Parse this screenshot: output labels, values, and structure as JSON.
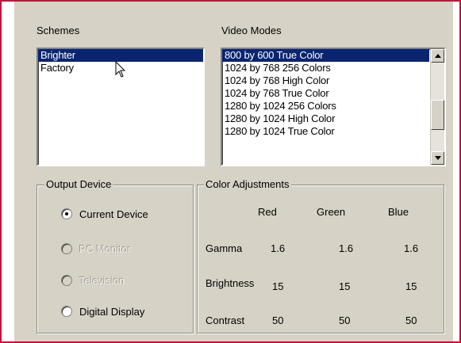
{
  "schemes": {
    "label": "Schemes",
    "items": [
      {
        "label": "Brighter",
        "selected": true
      },
      {
        "label": "Factory",
        "selected": false
      }
    ]
  },
  "video_modes": {
    "label": "Video Modes",
    "items": [
      {
        "label": "800 by 600 True Color",
        "selected": true
      },
      {
        "label": "1024 by 768 256 Colors",
        "selected": false
      },
      {
        "label": "1024 by 768 High Color",
        "selected": false
      },
      {
        "label": "1024 by 768 True Color",
        "selected": false
      },
      {
        "label": "1280 by 1024 256 Colors",
        "selected": false
      },
      {
        "label": "1280 by 1024 High Color",
        "selected": false
      },
      {
        "label": "1280 by 1024 True Color",
        "selected": false
      }
    ]
  },
  "output_device": {
    "title": "Output Device",
    "options": [
      {
        "label": "Current Device",
        "checked": true,
        "enabled": true
      },
      {
        "label": "PC Monitor",
        "checked": false,
        "enabled": false
      },
      {
        "label": "Television",
        "checked": false,
        "enabled": false
      },
      {
        "label": "Digital Display",
        "checked": false,
        "enabled": true
      }
    ]
  },
  "color_adjustments": {
    "title": "Color Adjustments",
    "columns": [
      "Red",
      "Green",
      "Blue"
    ],
    "rows": [
      {
        "label": "Gamma",
        "values": [
          "1.6",
          "1.6",
          "1.6"
        ]
      },
      {
        "label": "Brightness",
        "values": [
          "15",
          "15",
          "15"
        ]
      },
      {
        "label": "Contrast",
        "values": [
          "50",
          "50",
          "50"
        ]
      }
    ]
  },
  "colors": {
    "selection": "#0a2470",
    "panel": "#d7d2c6",
    "frame": "#c4123a"
  }
}
